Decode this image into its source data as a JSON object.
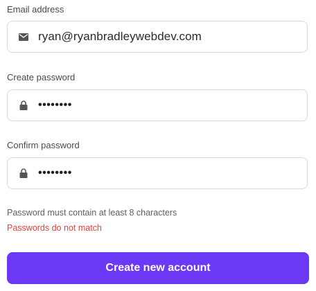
{
  "email": {
    "label": "Email address",
    "value": "ryan@ryanbradleywebdev.com",
    "icon": "envelope-icon"
  },
  "create_password": {
    "label": "Create password",
    "value": "••••••••",
    "icon": "lock-icon"
  },
  "confirm_password": {
    "label": "Confirm password",
    "value": "••••••••",
    "icon": "lock-icon"
  },
  "messages": {
    "hint": "Password must contain at least 8 characters",
    "error": "Passwords do not match"
  },
  "submit": {
    "label": "Create new account"
  },
  "colors": {
    "accent": "#6b39f5",
    "error": "#e0443a",
    "border": "#d8d8de"
  }
}
